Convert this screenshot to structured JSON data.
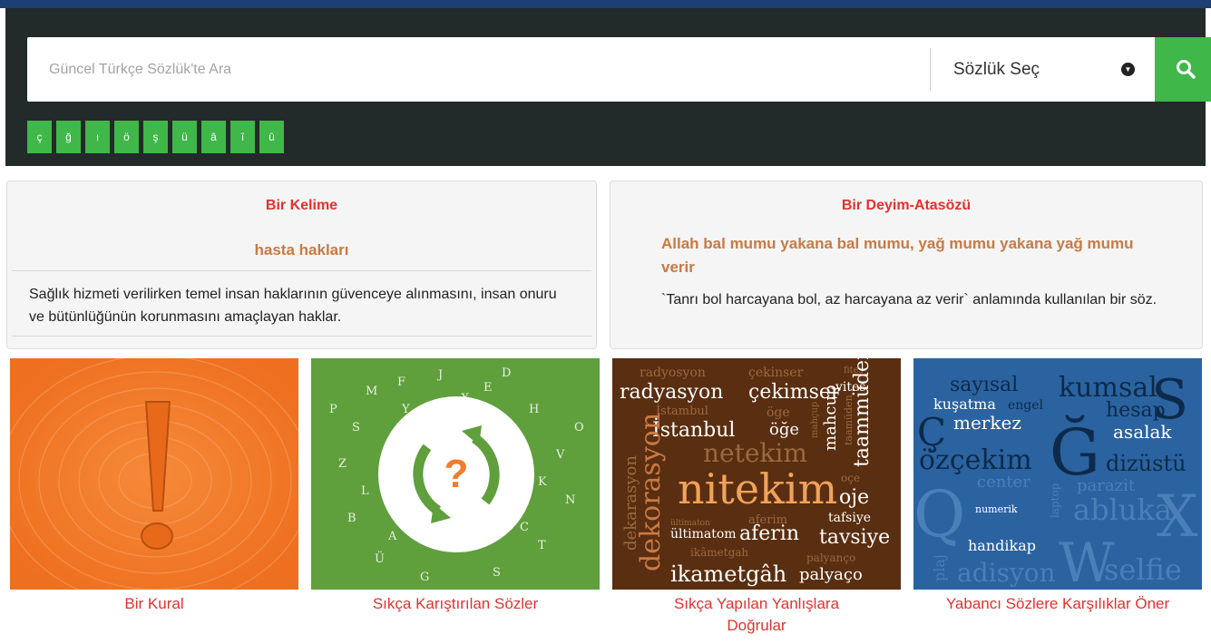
{
  "search": {
    "placeholder": "Güncel Türkçe Sözlük'te Ara",
    "dictionary_select": "Sözlük Seç",
    "search_icon": "search-icon"
  },
  "special_letters": [
    "ç",
    "ğ",
    "ı",
    "ö",
    "ş",
    "ü",
    "â",
    "î",
    "û"
  ],
  "word_of_day": {
    "title": "Bir Kelime",
    "term": "hasta hakları",
    "definition": "Sağlık hizmeti verilirken temel insan haklarının güvenceye alınmasını, insan onuru ve bütünlüğünün korunmasını amaçlayan haklar."
  },
  "idiom_of_day": {
    "title": "Bir Deyim-Atasözü",
    "term": "Allah bal mumu yakana bal mumu, yağ mumu yakana yağ mumu verir",
    "definition": "`Tanrı bol harcayana bol, az harcayana az verir` anlamında kullanılan bir söz."
  },
  "cards": [
    {
      "label": "Bir Kural",
      "color": "#f47b2a",
      "icon": "exclamation-icon"
    },
    {
      "label": "Sıkça Karıştırılan Sözler",
      "color": "#5f9f3c",
      "icon": "question-refresh-icon"
    },
    {
      "label": "Sıkça Yapılan Yanlışlara Doğrular",
      "color": "#5a2e10",
      "words": [
        "radyosyon",
        "çekinser",
        "fites",
        "radyasyon",
        "çekimser",
        "vites",
        "İstambul",
        "İstanbul",
        "öge",
        "öğe",
        "mahçup",
        "mahcup",
        "taamüden",
        "taammüden",
        "netekim",
        "dekarasyon",
        "dekorasyon",
        "nitekim",
        "oje",
        "oçe",
        "aferim",
        "tafsiye",
        "ültimaton",
        "ültimatom",
        "aferin",
        "tavsiye",
        "ikâmetgah",
        "palyanço",
        "ikametgâh",
        "palyaço"
      ]
    },
    {
      "label": "Yabancı Sözlere Karşılıklar Öner",
      "color": "#2a63a0",
      "words": [
        "sayısal",
        "kumsal",
        "S",
        "kuşatma",
        "engel",
        "hesap",
        "Ç",
        "merkez",
        "asalak",
        "Ğ",
        "özçekim",
        "dizüstü",
        "center",
        "parazit",
        "laptop",
        "Q",
        "numerik",
        "abluka",
        "X",
        "handikap",
        "plaj",
        "adisyon",
        "W",
        "selfie"
      ]
    }
  ]
}
